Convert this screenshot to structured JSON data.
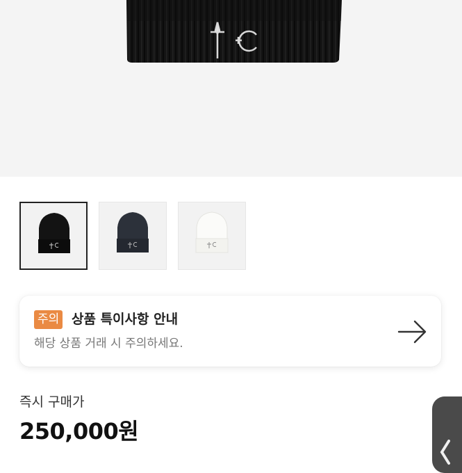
{
  "product": {
    "image": "black-beanie-with-star-moon-emblem",
    "thumbnails": [
      {
        "name": "black",
        "color": "#131313",
        "selected": true
      },
      {
        "name": "navy",
        "color": "#2a2e36",
        "selected": false
      },
      {
        "name": "white",
        "color": "#f1f1ee",
        "selected": false
      }
    ]
  },
  "notice": {
    "badge": "주의",
    "title": "상품 특이사항 안내",
    "description": "해당 상품 거래 시 주의하세요.",
    "icon": "arrow-right-icon",
    "badge_color": "#ea8a43"
  },
  "price": {
    "label": "즉시 구매가",
    "value": "250,000원"
  },
  "side_handle": {
    "icon": "chevron-left-icon"
  }
}
